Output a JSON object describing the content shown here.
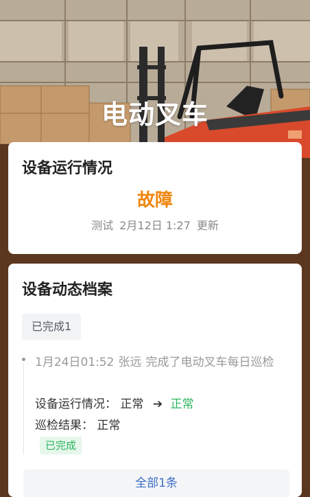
{
  "header": {
    "title": "电动叉车"
  },
  "status_card": {
    "title": "设备运行情况",
    "status": "故障",
    "updated_by": "测试",
    "updated_at": "2月12日 1:27",
    "updated_suffix": "更新",
    "status_color": "#f0860f"
  },
  "archive_card": {
    "title": "设备动态档案",
    "tab_label": "已完成1",
    "records": [
      {
        "time": "1月24日01:52",
        "user": "张远",
        "action": "完成了电动叉车每日巡检",
        "run_status_label": "设备运行情况：",
        "run_status_from": "正常",
        "run_status_to": "正常",
        "result_label": "巡检结果：",
        "result_value": "正常",
        "badge": "已完成"
      }
    ],
    "all_button": "全部1条"
  },
  "colors": {
    "accent_orange": "#f0860f",
    "success_green": "#2db55d",
    "link_blue": "#3b6ec4"
  },
  "icons": {
    "arrow": "arrow-right-icon"
  }
}
